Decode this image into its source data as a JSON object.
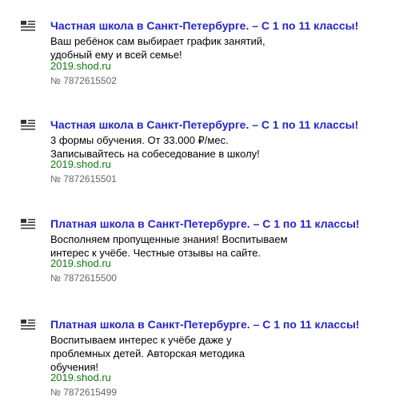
{
  "ads": [
    {
      "title": "Частная школа в Санкт-Петербурге. – С 1 по 11 классы!",
      "lines": [
        "Ваш ребёнок сам выбирает график занятий,",
        "удобный ему и всей семье!"
      ],
      "domain": "2019.shod.ru",
      "number": "№ 7872615502",
      "icon": "list-icon"
    },
    {
      "title": "Частная школа в Санкт-Петербурге. – С 1 по 11 классы!",
      "lines": [
        "3 формы обучения. От 33.000 ₽/мес.",
        "Записывайтесь на собеседование в школу!"
      ],
      "domain": "2019.shod.ru",
      "number": "№ 7872615501",
      "icon": "list-icon"
    },
    {
      "title": "Платная школа в Санкт-Петербурге. – С 1 по 11 классы!",
      "lines": [
        "Восполняем пропущенные знания! Воспитываем",
        "интерес к учёбе. Честные отзывы на сайте."
      ],
      "domain": "2019.shod.ru",
      "number": "№ 7872615500",
      "icon": "list-icon"
    },
    {
      "title": "Платная школа в Санкт-Петербурге. – С 1 по 11 классы!",
      "lines": [
        "Воспитываем интерес к учёбе даже у",
        "проблемных детей. Авторская методика",
        "обучения!"
      ],
      "domain": "2019.shod.ru",
      "number": "№ 7872615499",
      "icon": "list-icon"
    }
  ],
  "colors": {
    "title": "#2626c8",
    "domain": "#127a12",
    "number": "#666666",
    "icon": "#333333"
  }
}
